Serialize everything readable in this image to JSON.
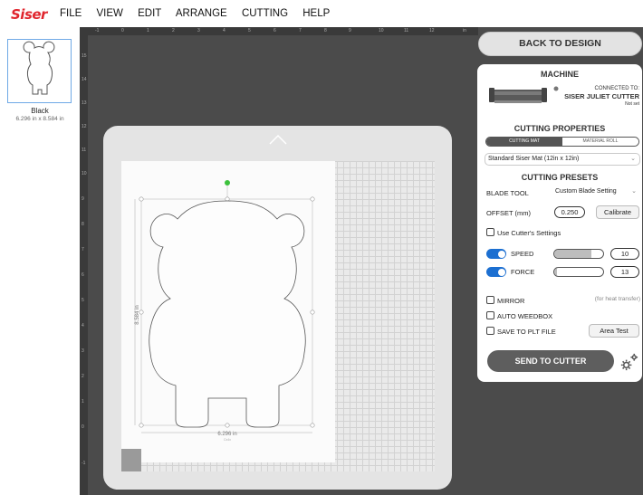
{
  "app": {
    "logo": "Siser",
    "brand_color": "#e0262e",
    "accent_color": "#1c6fd1"
  },
  "menu": [
    "FILE",
    "VIEW",
    "EDIT",
    "ARRANGE",
    "CUTTING",
    "HELP"
  ],
  "layers": [
    {
      "name": "Black",
      "size": "6.296 in x 8.584 in"
    }
  ],
  "ruler": {
    "top": [
      "-1",
      "0",
      "1",
      "2",
      "3",
      "4",
      "5",
      "6",
      "7",
      "8",
      "9",
      "10",
      "11",
      "12",
      "in"
    ],
    "left": [
      "0",
      "15",
      "14",
      "13",
      "12",
      "11",
      "10",
      "9",
      "8",
      "7",
      "6",
      "5",
      "4",
      "3",
      "2",
      "1",
      "0",
      "-1"
    ]
  },
  "design": {
    "width_label": "6.296 in",
    "height_label": "8.584 in",
    "width_sub": "Cx4x",
    "height_sub": "Cx4x"
  },
  "panel": {
    "back_button": "BACK TO DESIGN",
    "machine_title": "MACHINE",
    "connected_label": "CONNECTED TO:",
    "machine_name": "SISER JULIET CUTTER",
    "machine_status": "Not set",
    "cutting_properties_title": "CUTTING PROPERTIES",
    "mode_options": [
      "CUTTING MAT",
      "MATERIAL ROLL"
    ],
    "mode_selected": "CUTTING MAT",
    "mat_select": "Standard Siser Mat (12in x 12in)",
    "cutting_presets_title": "CUTTING PRESETS",
    "blade_tool_label": "BLADE TOOL",
    "blade_tool_value": "Custom Blade Setting",
    "offset_label": "OFFSET (mm)",
    "offset_value": "0.250",
    "calibrate_button": "Calibrate",
    "use_cutter_settings_label": "Use Cutter's Settings",
    "speed_label": "SPEED",
    "speed_value": "10",
    "speed_fraction": 0.75,
    "force_label": "FORCE",
    "force_value": "13",
    "force_fraction": 0.06,
    "mirror_label": "MIRROR",
    "mirror_note": "(for heat transfer)",
    "auto_weedbox_label": "AUTO WEEDBOX",
    "save_plt_label": "SAVE TO PLT FILE",
    "area_test_button": "Area Test",
    "send_button": "SEND TO CUTTER"
  }
}
